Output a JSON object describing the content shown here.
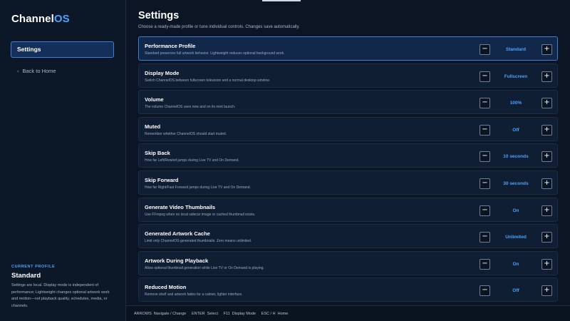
{
  "app": {
    "name_primary": "Channel",
    "name_accent": "OS"
  },
  "sidebar": {
    "nav_settings": "Settings",
    "nav_back": "Back to Home",
    "current_profile_caption": "CURRENT PROFILE",
    "current_profile_name": "Standard",
    "current_profile_desc": "Settings are local. Display mode is independent of performance; Lightweight changes optional artwork work and motion—not playback quality, schedules, media, or channels."
  },
  "header": {
    "title": "Settings",
    "subtitle": "Choose a ready-made profile or tune individual controls. Changes save automatically."
  },
  "settings": [
    {
      "title": "Performance Profile",
      "desc": "Standard preserves full artwork behavior. Lightweight reduces optional background work.",
      "value": "Standard"
    },
    {
      "title": "Display Mode",
      "desc": "Switch ChannelOS between fullscreen television and a normal desktop window.",
      "value": "Fullscreen"
    },
    {
      "title": "Volume",
      "desc": "The volume ChannelOS uses now and on its next launch.",
      "value": "100%"
    },
    {
      "title": "Muted",
      "desc": "Remember whether ChannelOS should start muted.",
      "value": "Off"
    },
    {
      "title": "Skip Back",
      "desc": "How far Left/Rewind jumps during Live TV and On Demand.",
      "value": "10 seconds"
    },
    {
      "title": "Skip Forward",
      "desc": "How far Right/Fast Forward jumps during Live TV and On Demand.",
      "value": "30 seconds"
    },
    {
      "title": "Generate Video Thumbnails",
      "desc": "Use FFmpeg when no local sidecar image or cached thumbnail exists.",
      "value": "On"
    },
    {
      "title": "Generated Artwork Cache",
      "desc": "Limit only ChannelOS-generated thumbnails. Zero means unlimited.",
      "value": "Unlimited"
    },
    {
      "title": "Artwork During Playback",
      "desc": "Allow optional thumbnail generation while Live TV or On Demand is playing.",
      "value": "On"
    },
    {
      "title": "Reduced Motion",
      "desc": "Remove shelf and artwork fades for a calmer, lighter interface.",
      "value": "Off"
    }
  ],
  "controls": {
    "minus": "−",
    "plus": "+"
  },
  "icons": {
    "back": "chevron-left-icon"
  },
  "footer": {
    "hints": "ARROWS  Navigate / Change     ENTER  Select     F11  Display Mode     ESC / H  Home"
  },
  "colors": {
    "accent": "#4aa3ff",
    "background": "#0b1524",
    "active_row": "#12284a",
    "active_border": "#3d7fd6"
  }
}
